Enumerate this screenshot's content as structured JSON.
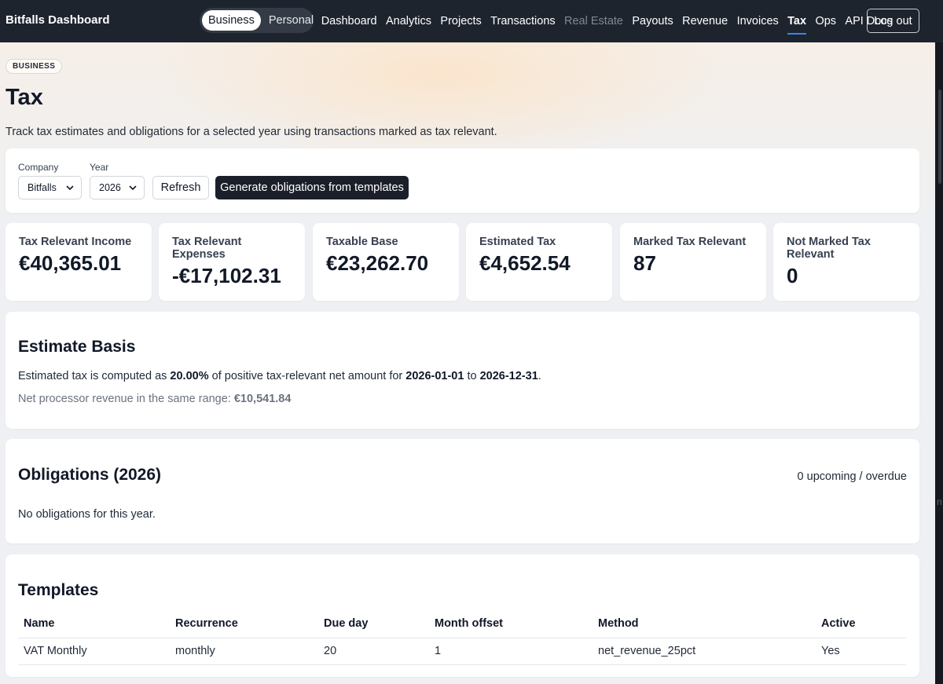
{
  "header": {
    "brand": "Bitfalls Dashboard",
    "mode_toggle": [
      "Business",
      "Personal"
    ],
    "nav": [
      {
        "label": "Dashboard",
        "state": "normal"
      },
      {
        "label": "Analytics",
        "state": "normal"
      },
      {
        "label": "Projects",
        "state": "normal"
      },
      {
        "label": "Transactions",
        "state": "normal"
      },
      {
        "label": "Real Estate",
        "state": "muted"
      },
      {
        "label": "Payouts",
        "state": "normal"
      },
      {
        "label": "Revenue",
        "state": "normal"
      },
      {
        "label": "Invoices",
        "state": "normal"
      },
      {
        "label": "Tax",
        "state": "active"
      },
      {
        "label": "Ops",
        "state": "normal"
      },
      {
        "label": "API Docs",
        "state": "normal"
      }
    ],
    "logout_label": "Log out"
  },
  "page": {
    "badge": "BUSINESS",
    "title": "Tax",
    "subtitle": "Track tax estimates and obligations for a selected year using transactions marked as tax relevant."
  },
  "filters": {
    "company_label": "Company",
    "company_value": "Bitfalls",
    "year_label": "Year",
    "year_value": "2026",
    "refresh_label": "Refresh",
    "generate_label": "Generate obligations from templates"
  },
  "stats": [
    {
      "label": "Tax Relevant Income",
      "value": "€40,365.01"
    },
    {
      "label": "Tax Relevant Expenses",
      "value": "-€17,102.31"
    },
    {
      "label": "Taxable Base",
      "value": "€23,262.70"
    },
    {
      "label": "Estimated Tax",
      "value": "€4,652.54"
    },
    {
      "label": "Marked Tax Relevant",
      "value": "87"
    },
    {
      "label": "Not Marked Tax Relevant",
      "value": "0"
    }
  ],
  "estimate": {
    "heading": "Estimate Basis",
    "text_1": "Estimated tax is computed as ",
    "rate": "20.00%",
    "text_2": " of positive tax-relevant net amount for ",
    "start": "2026-01-01",
    "text_3": " to ",
    "end": "2026-12-31",
    "text_4": ".",
    "revenue_text": "Net processor revenue in the same range: ",
    "revenue_value": "€10,541.84"
  },
  "obligations": {
    "heading": "Obligations (2026)",
    "count_text": "0 upcoming / overdue",
    "empty_text": "No obligations for this year."
  },
  "templates": {
    "heading": "Templates",
    "columns": [
      "Name",
      "Recurrence",
      "Due day",
      "Month offset",
      "Method",
      "Active"
    ],
    "rows": [
      [
        "VAT Monthly",
        "monthly",
        "20",
        "1",
        "net_revenue_25pct",
        "Yes"
      ]
    ]
  },
  "scroll_edge_glyph": "n",
  "colors": {
    "topbar": "#1e242e",
    "primary_button": "#1a1f29",
    "active_underline": "#3b82f6"
  }
}
